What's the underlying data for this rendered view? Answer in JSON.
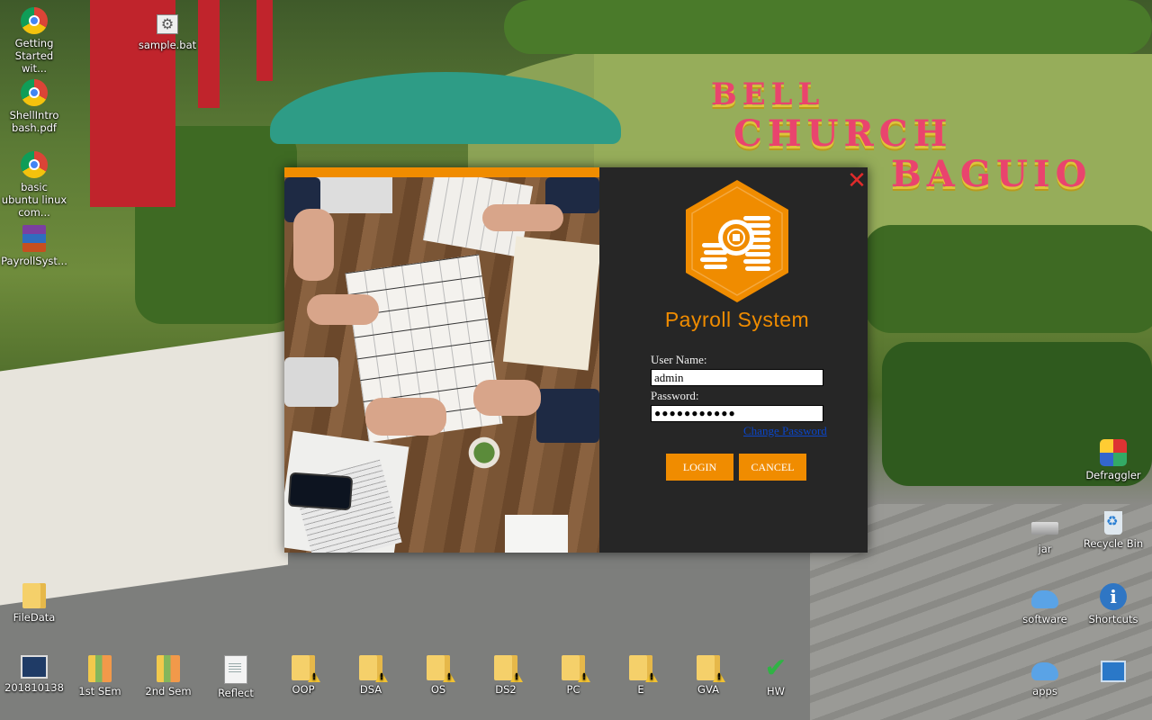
{
  "desktop": {
    "icons": {
      "getting_started": "Getting Started wit...",
      "sample_bat": "sample.bat",
      "shellintro": "ShellIntro bash.pdf",
      "basic_ubuntu": "basic ubuntu linux com...",
      "payroll_system": "PayrollSyst...",
      "filedata": "FileData",
      "num_201810138": "201810138",
      "first_sem": "1st SEm",
      "second_sem": "2nd Sem",
      "reflect": "Reflect",
      "oop": "OOP",
      "dsa": "DSA",
      "os": "OS",
      "ds2": "DS2",
      "pc": "PC",
      "e": "E",
      "gva": "GVA",
      "hw": "HW",
      "defraggler": "Defraggler",
      "jar": "jar",
      "recycle_bin": "Recycle Bin",
      "software": "software",
      "shortcuts": "Shortcuts",
      "apps": "apps"
    }
  },
  "dialog": {
    "title": "Payroll System",
    "close_icon": "close-icon",
    "username_label": "User Name:",
    "username_value": "admin",
    "password_label": "Password:",
    "password_masked": "●●●●●●●●●●●",
    "change_password": "Change Password",
    "login_label": "LOGIN",
    "cancel_label": "CANCEL",
    "accent_color": "#f08c00",
    "background_color": "#262626"
  }
}
